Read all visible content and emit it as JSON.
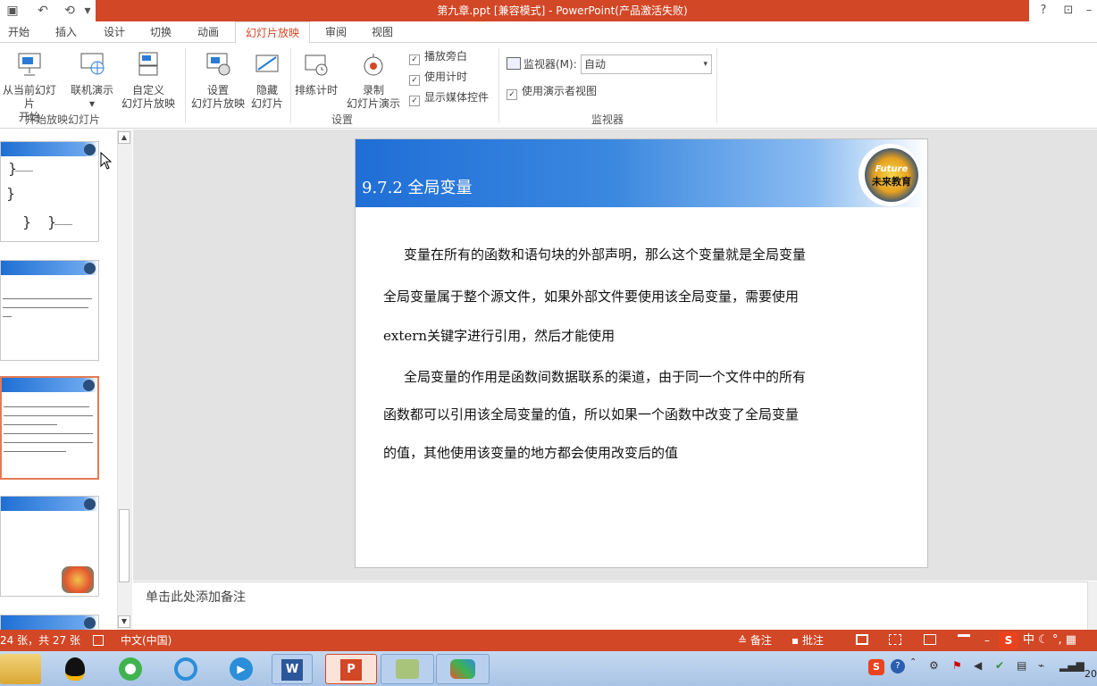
{
  "window": {
    "title": "第九章.ppt [兼容模式] -  PowerPoint(产品激活失败)",
    "help": "?",
    "restore": "⊡",
    "minimize": "–"
  },
  "tabs": [
    "开始",
    "插入",
    "设计",
    "切换",
    "动画",
    "幻灯片放映",
    "审阅",
    "视图"
  ],
  "active_tab": "幻灯片放映",
  "ribbon": {
    "start_group": {
      "label": "开始放映幻灯片",
      "from_current_1": "从当前幻灯片",
      "from_current_2": "开始",
      "online_1": "联机演示",
      "custom_1": "自定义",
      "custom_2": "幻灯片放映"
    },
    "setup_group": {
      "label": "设置",
      "setup_1": "设置",
      "setup_2": "幻灯片放映",
      "hide_1": "隐藏",
      "hide_2": "幻灯片",
      "rehearse": "排练计时",
      "record_1": "录制",
      "record_2": "幻灯片演示",
      "cb_narration": "播放旁白",
      "cb_timing": "使用计时",
      "cb_media": "显示媒体控件"
    },
    "monitor_group": {
      "label": "监视器",
      "monitor_label": "监视器(M):",
      "monitor_value": "自动",
      "presenter_view": "使用演示者视图"
    }
  },
  "slide": {
    "title": "9.7.2 全局变量",
    "logo_top": "Future",
    "logo_bottom": "未来教育",
    "p1": "变量在所有的函数和语句块的外部声明，那么这个变量就是全局变量",
    "p2": "全局变量属于整个源文件，如果外部文件要使用该全局变量，需要使用",
    "p3": "extern关键字进行引用，然后才能使用",
    "p4": "全局变量的作用是函数间数据联系的渠道，由于同一个文件中的所有",
    "p5": "函数都可以引用该全局变量的值，所以如果一个函数中改变了全局变量",
    "p6": "的值，其他使用该变量的地方都会使用改变后的值"
  },
  "notes": {
    "placeholder": "单击此处添加备注"
  },
  "statusbar": {
    "slide_counter": "24 张，共 27 张",
    "language": "中文(中国)",
    "notes": "备注",
    "comments": "批注",
    "ime": "中"
  },
  "taskbar": {
    "clock": "20"
  }
}
